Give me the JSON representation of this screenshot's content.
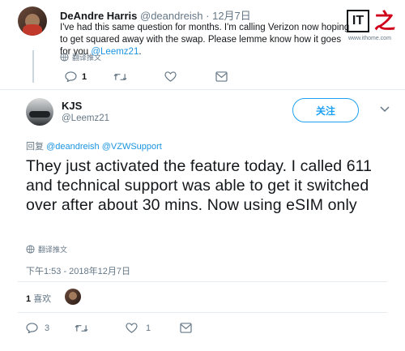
{
  "reply_tweet": {
    "author_name": "DeAndre Harris",
    "author_handle": "@deandreish",
    "date": "· 12月7日",
    "text_before_link": "I've had this same question for months. I'm calling Verizon now hoping to get squared away with the swap. Please lemme know how it goes for you ",
    "text_link": "@Leemz21",
    "text_after_link": ".",
    "translate_label": "翻译推文",
    "reply_count": "1"
  },
  "main_tweet": {
    "author_name": "KJS",
    "author_handle": "@Leemz21",
    "follow_label": "关注",
    "replying_prefix": "回复",
    "replying_to_1": "@deandreish",
    "replying_to_2": "@VZWSupport",
    "text": "They just activated the feature today. I called 611 and technical support was able to get it switched over after about 30 mins. Now using eSIM only",
    "translate_label": "翻译推文",
    "timestamp": "下午1:53 - 2018年12月7日",
    "like_count": "1",
    "like_label": "喜欢",
    "reply_count": "3",
    "favorite_count": "1"
  },
  "watermark": {
    "logo_text": "IT",
    "logo_char": "之",
    "site": "www.ithome.com"
  },
  "colors": {
    "link": "#1b95e0",
    "muted": "#657786",
    "accent": "#1da1f2",
    "divider": "#e6ecf0",
    "watermark_red": "#d0021b"
  },
  "icons": [
    "reply-icon",
    "retweet-icon",
    "like-icon",
    "message-icon",
    "globe-icon",
    "more-icon"
  ]
}
